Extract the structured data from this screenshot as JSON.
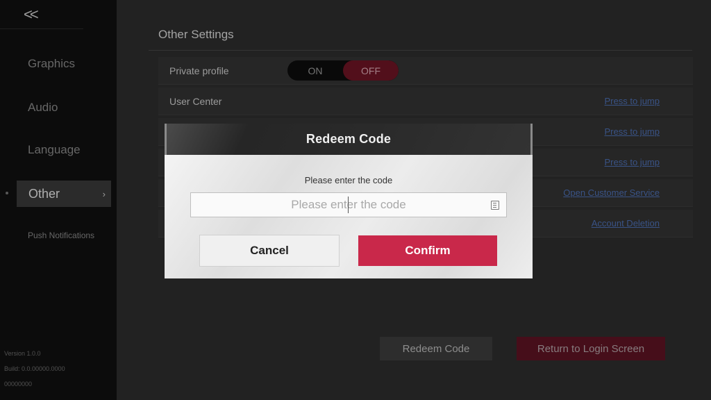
{
  "sidebar": {
    "back_icon": "double-chevron-left-icon",
    "back_glyph": "<<",
    "items": [
      {
        "label": "Graphics"
      },
      {
        "label": "Audio"
      },
      {
        "label": "Language"
      },
      {
        "label": "Other",
        "active": true
      },
      {
        "label": "Push Notifications"
      }
    ],
    "version_lines": [
      "Version 1.0.0",
      "Build: 0.0.00000.0000",
      "00000000"
    ]
  },
  "settings": {
    "section_title": "Other Settings",
    "rows": [
      {
        "label": "Private profile",
        "toggle": {
          "on": "ON",
          "off": "OFF",
          "selected": "OFF"
        }
      },
      {
        "label": "User Center",
        "link": "Press to jump"
      },
      {
        "label": "",
        "link": "Press to jump"
      },
      {
        "label": "",
        "link": "Press to jump"
      },
      {
        "label": "",
        "link": "Open Customer Service"
      },
      {
        "label": "",
        "link": "Account Deletion"
      }
    ],
    "redeem_button": "Redeem Code",
    "login_button": "Return to Login Screen"
  },
  "modal": {
    "title": "Redeem Code",
    "prompt": "Please enter the code",
    "input_value": "",
    "input_placeholder": "Please enter the code",
    "paste_icon": "paste-icon",
    "cancel_label": "Cancel",
    "confirm_label": "Confirm",
    "confirm_color": "#c9284a"
  }
}
